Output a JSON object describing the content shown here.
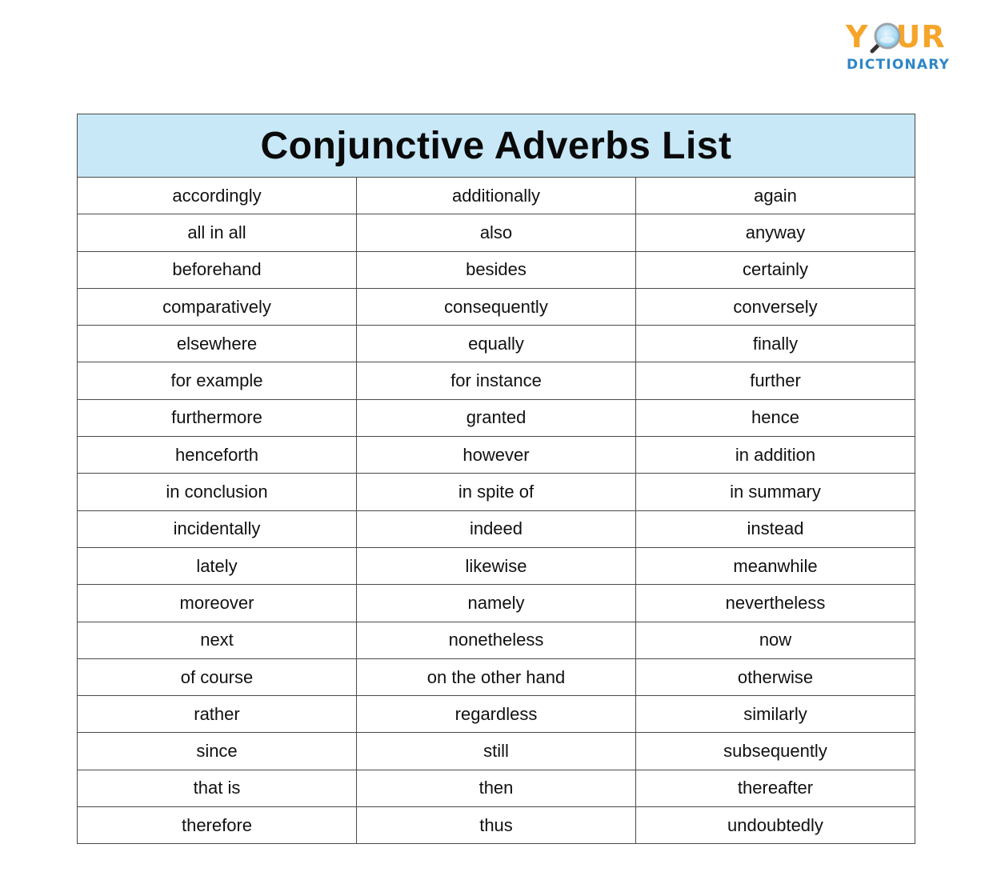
{
  "logo": {
    "top_text": "YOUR",
    "bottom_text": "DICTIONARY",
    "icon": "magnifying-glass-icon",
    "colors": {
      "top": "#f5a52a",
      "bottom": "#2e86c8",
      "lens": "#bfe4f7"
    }
  },
  "table": {
    "title": "Conjunctive Adverbs List",
    "header_bg": "#c8e8f8",
    "rows": [
      [
        "accordingly",
        "additionally",
        "again"
      ],
      [
        "all in all",
        "also",
        "anyway"
      ],
      [
        "beforehand",
        "besides",
        "certainly"
      ],
      [
        "comparatively",
        "consequently",
        "conversely"
      ],
      [
        "elsewhere",
        "equally",
        "finally"
      ],
      [
        "for example",
        "for instance",
        "further"
      ],
      [
        "furthermore",
        "granted",
        "hence"
      ],
      [
        "henceforth",
        "however",
        "in addition"
      ],
      [
        "in conclusion",
        "in spite of",
        "in summary"
      ],
      [
        "incidentally",
        "indeed",
        "instead"
      ],
      [
        "lately",
        "likewise",
        "meanwhile"
      ],
      [
        "moreover",
        "namely",
        "nevertheless"
      ],
      [
        "next",
        "nonetheless",
        "now"
      ],
      [
        "of course",
        "on the other hand",
        "otherwise"
      ],
      [
        "rather",
        "regardless",
        "similarly"
      ],
      [
        "since",
        "still",
        "subsequently"
      ],
      [
        "that is",
        "then",
        "thereafter"
      ],
      [
        "therefore",
        "thus",
        "undoubtedly"
      ]
    ]
  }
}
